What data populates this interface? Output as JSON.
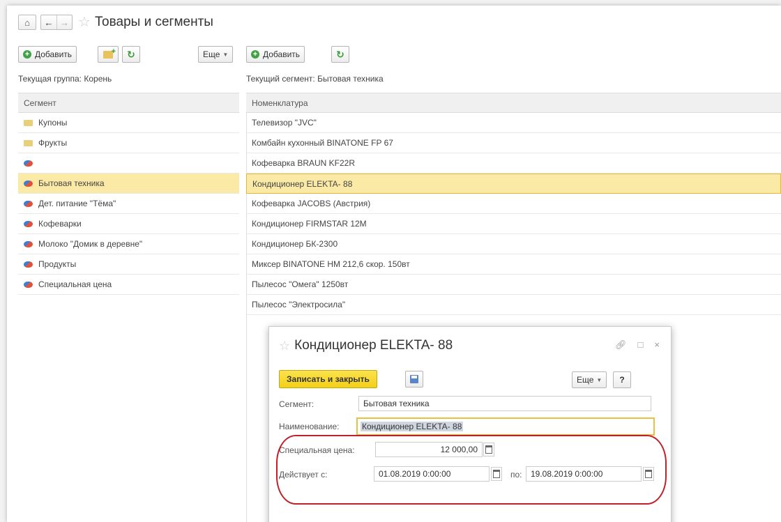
{
  "window": {
    "title": "Товары и сегменты"
  },
  "left_panel": {
    "add_label": "Добавить",
    "current_group_label": "Текущая группа:",
    "current_group_value": "Корень",
    "column_header": "Сегмент",
    "rows": [
      {
        "label": "Купоны",
        "icon": "folder-icon"
      },
      {
        "label": "Фрукты",
        "icon": "folder-icon"
      },
      {
        "label": "",
        "icon": "segment-icon"
      },
      {
        "label": "Бытовая техника",
        "icon": "segment-icon",
        "selected": true
      },
      {
        "label": "Дет. питание \"Тёма\"",
        "icon": "segment-icon"
      },
      {
        "label": "Кофеварки",
        "icon": "segment-icon"
      },
      {
        "label": "Молоко \"Домик в деревне\"",
        "icon": "segment-icon"
      },
      {
        "label": "Продукты",
        "icon": "segment-icon"
      },
      {
        "label": "Специальная цена",
        "icon": "segment-icon"
      }
    ]
  },
  "right_panel": {
    "more_label": "Еще",
    "add_label": "Добавить",
    "current_segment_label": "Текущий сегмент:",
    "current_segment_value": "Бытовая техника",
    "column_header": "Номенклатура",
    "rows": [
      "Телевизор \"JVC\"",
      "Комбайн кухонный BINATONE FP 67",
      "Кофеварка BRAUN KF22R",
      "Кондиционер ELEKTA- 88",
      "Кофеварка JACOBS (Австрия)",
      "Кондиционер FIRMSTAR 12M",
      "Кондиционер БК-2300",
      "Миксер BINATONE HM 212,6 скор. 150вт",
      "Пылесос \"Омега\" 1250вт",
      "Пылесос \"Электросила\""
    ],
    "selected_index": 3
  },
  "dialog": {
    "title": "Кондиционер ELEKTA- 88",
    "save_close_label": "Записать и закрыть",
    "more_label": "Еще",
    "help_label": "?",
    "segment_label": "Сегмент:",
    "segment_value": "Бытовая техника",
    "name_label": "Наименование:",
    "name_value": "Кондиционер ELEKTA- 88",
    "special_price_label": "Специальная цена:",
    "special_price_value": "12 000,00",
    "valid_from_label": "Действует с:",
    "valid_from_value": "01.08.2019  0:00:00",
    "to_label": "по:",
    "valid_to_value": "19.08.2019  0:00:00"
  },
  "colors": {
    "accent_yellow": "#f2cf19",
    "selection": "#fbe9a6",
    "highlight_oval": "#c0202a",
    "add_green": "#43a047"
  }
}
